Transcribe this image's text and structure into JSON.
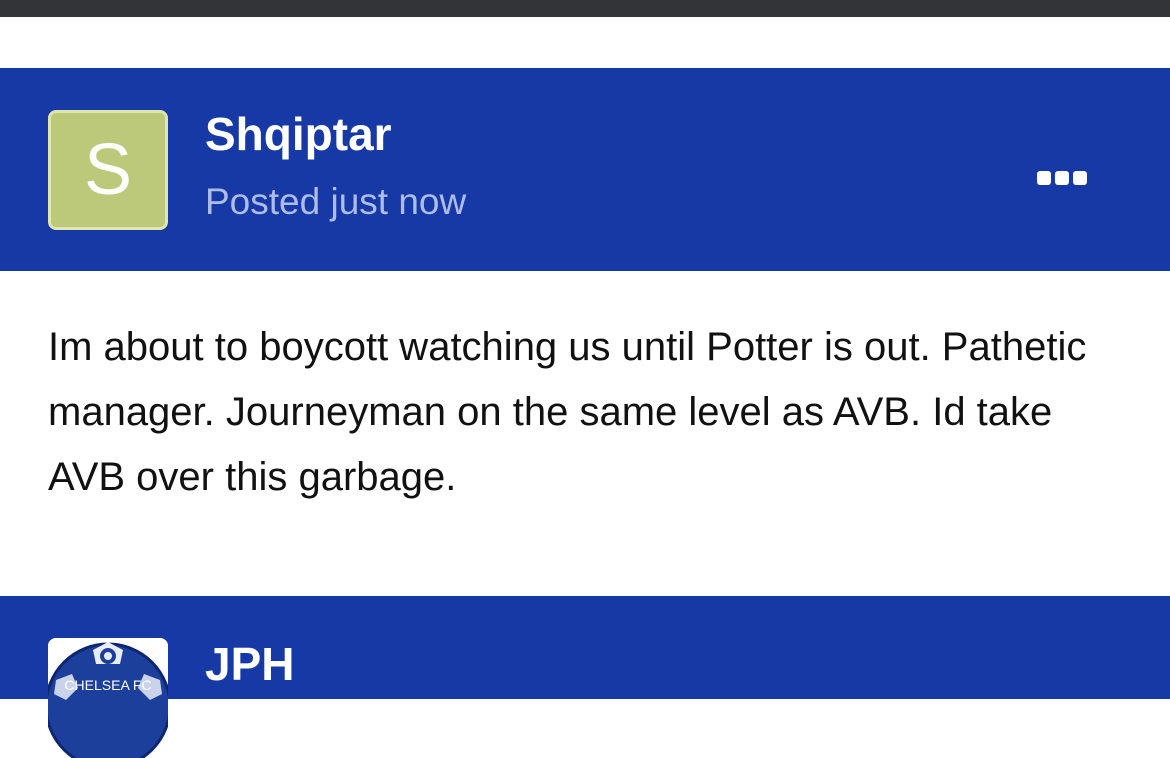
{
  "posts": [
    {
      "username": "Shqiptar",
      "avatar_letter": "S",
      "posted": "Posted just now",
      "body": "Im about to boycott watching us until Potter is out. Pathetic manager. Journeyman on the same level as AVB. Id take AVB over this garbage."
    },
    {
      "username": "JPH",
      "avatar_text": "CHELSEA FC"
    }
  ],
  "colors": {
    "header_bg": "#1739a6",
    "avatar_bg": "#bcc87a",
    "posted_text": "#aebde6",
    "top_bar": "#333438"
  },
  "icons": {
    "more": "more-options-icon"
  }
}
